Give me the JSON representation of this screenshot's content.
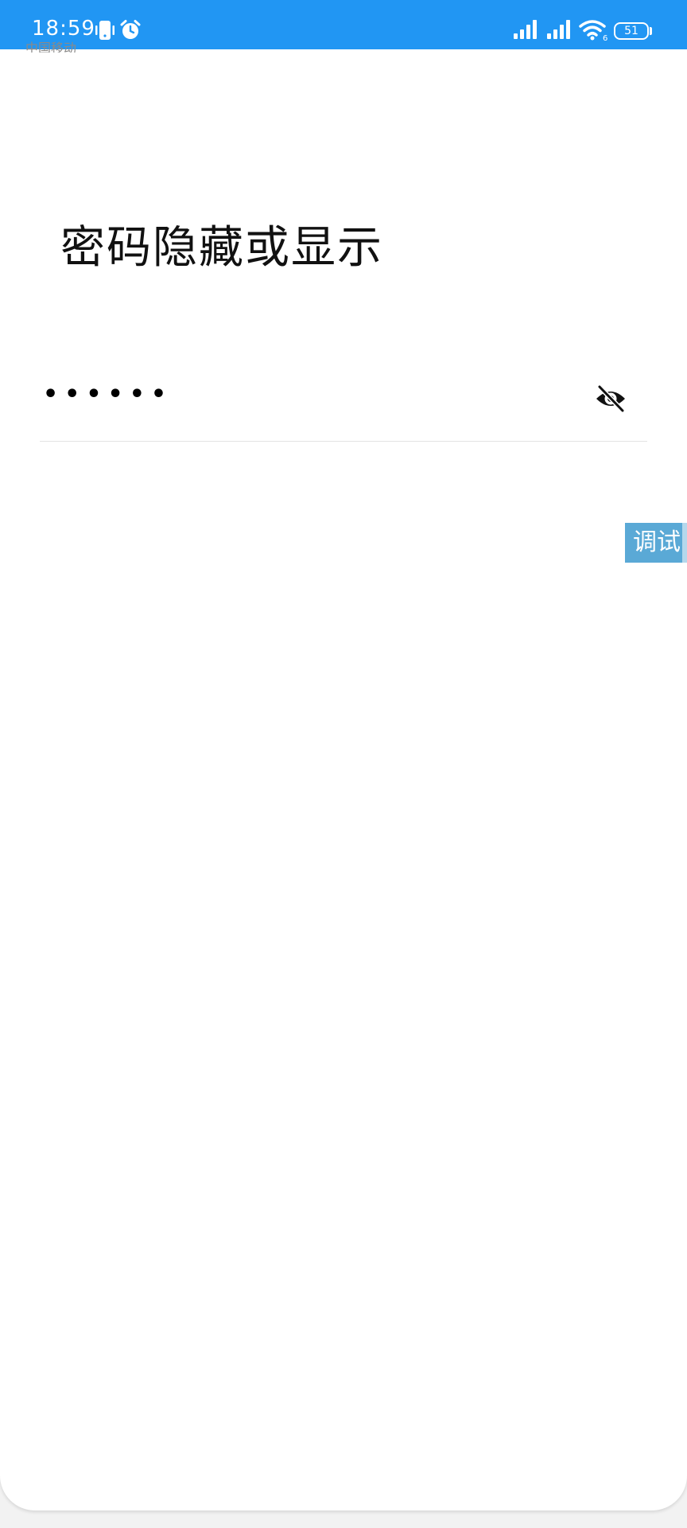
{
  "status_bar": {
    "time": "18:59",
    "carrier": "中国移动",
    "battery": "51",
    "icons": [
      "phone-vibrate-icon",
      "alarm-icon",
      "signal-icon",
      "signal-icon",
      "wifi-icon",
      "battery-icon"
    ],
    "background_color": "#2196f3"
  },
  "page": {
    "title": "密码隐藏或显示"
  },
  "password_field": {
    "masked_value": "••••••",
    "toggle_icon": "eye-off-icon"
  },
  "debug_button": {
    "label": "调试"
  }
}
